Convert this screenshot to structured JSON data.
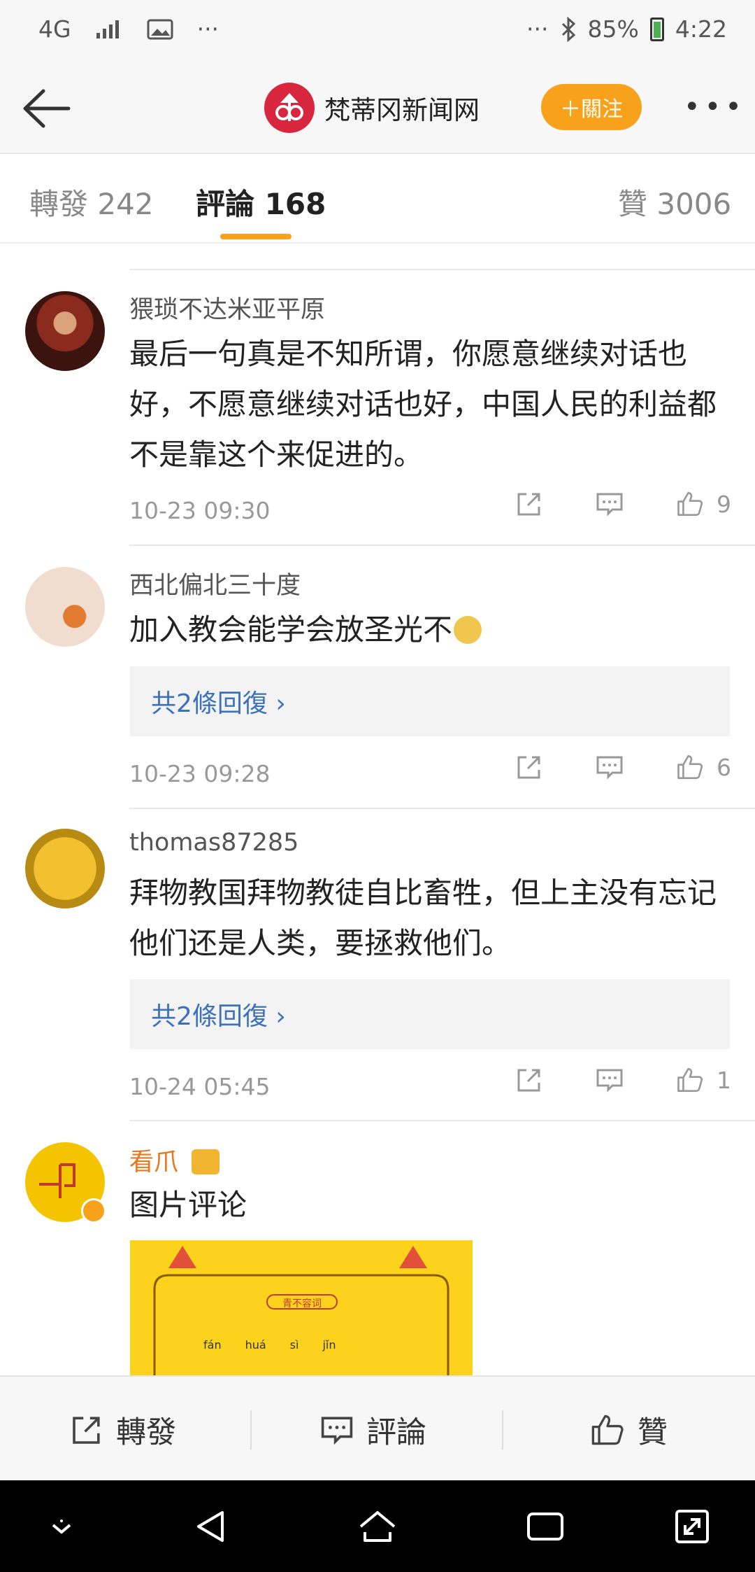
{
  "status_bar": {
    "network": "4G",
    "more": "···",
    "battery": "85%",
    "time": "4:22"
  },
  "header": {
    "account_name": "梵蒂冈新闻网",
    "follow_label": "＋關注",
    "more": "•••"
  },
  "tabs": [
    {
      "label": "轉發 242"
    },
    {
      "label": "評論 168"
    },
    {
      "label": "贊 3006"
    }
  ],
  "comments": [
    {
      "user": "猥琐不达米亚平原",
      "text": "最后一句真是不知所谓，你愿意继续对话也好，不愿意继续对话也好，中国人民的利益都不是靠这个来促进的。",
      "time": "10-23 09:30",
      "likes": "9"
    },
    {
      "user": "西北偏北三十度",
      "text": "加入教会能学会放圣光不",
      "replies": "共2條回復 ›",
      "time": "10-23 09:28",
      "likes": "6"
    },
    {
      "user": "thomas87285",
      "text": "拜物教国拜物教徒自比畜牲，但上主没有忘记他们还是人类，要拯救他们。",
      "replies": "共2條回復 ›",
      "time": "10-24 05:45",
      "likes": "1"
    },
    {
      "user": "看爪",
      "text": "图片评论"
    }
  ],
  "picture": {
    "tag": "青不容词",
    "pinyin": [
      "fán",
      "huá",
      "sì",
      "jǐn"
    ]
  },
  "bottom_bar": {
    "repost": "轉發",
    "comment": "評論",
    "like": "贊"
  },
  "colors": {
    "accent": "#f7a21a",
    "link": "#3b71b9",
    "brand": "#d7263d"
  }
}
